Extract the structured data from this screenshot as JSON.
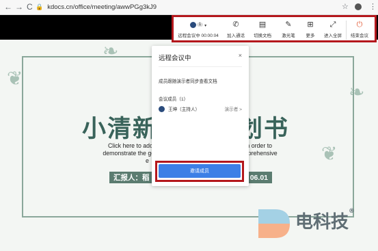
{
  "browser": {
    "url": "kdocs.cn/office/meeting/awwPGg3kJ9",
    "back_icon": "←",
    "forward_icon": "→",
    "reload_icon": "C",
    "star_icon": "☆",
    "menu_icon": "⋮"
  },
  "toolbar": {
    "participant_count": "1",
    "meeting_label": "远程会议中",
    "meeting_time": "00:00:04",
    "join_call": "加入通话",
    "switch_doc": "切换文档",
    "laser_pointer": "激光笔",
    "more": "更多",
    "fullscreen": "进入全屏",
    "end_meeting": "结束会议"
  },
  "slide": {
    "title_left": "小清新",
    "title_right": "划书",
    "english_line1": "Click here to add the",
    "english_line1_right": "n, in order to",
    "english_line2": "demonstrate the good",
    "english_line2_right": "comprehensive",
    "english_line3": "e",
    "reporter_left": "汇报人：稻",
    "reporter_right": "06.01"
  },
  "dialog": {
    "title": "远程会议中",
    "close": "×",
    "note": "成员跟随演示者同步查看文档",
    "member_count": "会议成员（1）",
    "member_name": "王坤（主持人）",
    "member_role": "演示者 >",
    "invite_button": "邀请成员"
  },
  "watermark": {
    "text": "电科技",
    "registered": "®"
  },
  "colors": {
    "accent_red": "#b4171c",
    "button_blue": "#3d7fe6",
    "title_green": "#39635a"
  }
}
